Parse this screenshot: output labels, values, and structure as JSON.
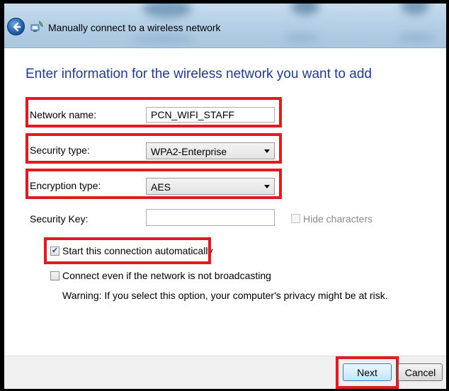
{
  "window": {
    "title": "Manually connect to a wireless network",
    "heading": "Enter information for the wireless network you want to add"
  },
  "form": {
    "network_name": {
      "label": "Network name:",
      "value": "PCN_WIFI_STAFF"
    },
    "security_type": {
      "label": "Security type:",
      "value": "WPA2-Enterprise"
    },
    "encryption_type": {
      "label": "Encryption type:",
      "value": "AES"
    },
    "security_key": {
      "label": "Security Key:",
      "value": ""
    },
    "hide_characters": {
      "label": "Hide characters",
      "checked": false,
      "enabled": false
    },
    "start_automatically": {
      "label": "Start this connection automatically",
      "checked": true
    },
    "connect_not_broadcasting": {
      "label": "Connect even if the network is not broadcasting",
      "checked": false
    },
    "warning": "Warning: If you select this option, your computer's privacy might be at risk."
  },
  "buttons": {
    "next": "Next",
    "cancel": "Cancel"
  },
  "colors": {
    "highlight": "#e21b23",
    "heading": "#1e3c96",
    "titlebar": "#b5d0e6"
  },
  "icons": {
    "back": "back-arrow-icon",
    "network": "wireless-network-icon",
    "arrow": "chevron-down-icon",
    "check": "check-icon"
  }
}
